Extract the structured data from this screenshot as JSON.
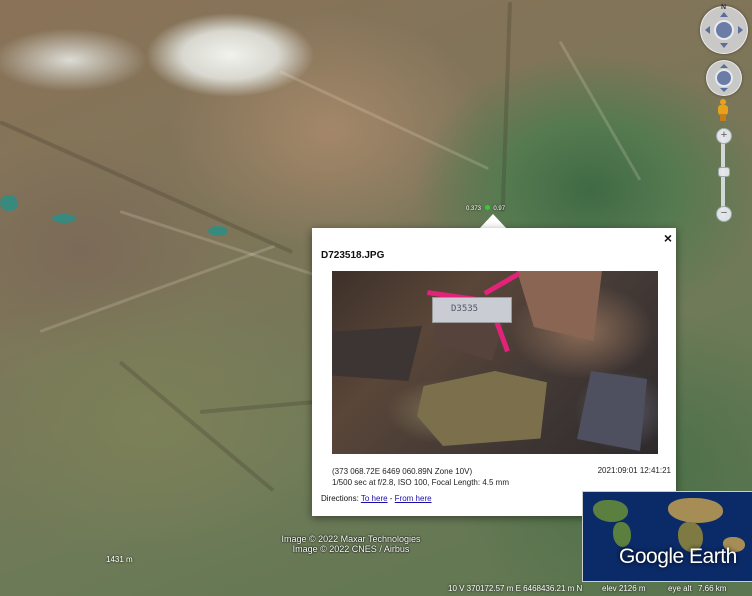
{
  "map": {
    "scale_label": "1431 m",
    "attribution_lines": [
      "Image © 2022 Maxar Technologies",
      "Image © 2022 CNES / Airbus"
    ],
    "marker_labels": [
      "0.373",
      "0.97"
    ]
  },
  "navigation": {
    "compass_north": "N",
    "zoom_in": "+",
    "zoom_out": "−"
  },
  "popup": {
    "title": "D723518.JPG",
    "close_symbol": "×",
    "photo_tag_text": "D3535",
    "coordinates": "(373 068.72E 6469 060.89N Zone 10V)",
    "exposure": "1/500 sec at f/2.8, ISO 100, Focal Length: 4.5 mm",
    "datetime": "2021:09:01 12:41:21",
    "directions_prefix": "Directions:",
    "to_here": "To here",
    "separator": " - ",
    "from_here": "From here"
  },
  "status_bar": {
    "coordinates": "10 V 370172.57 m E 6468436.21 m N",
    "elevation": "elev  2126 m",
    "eye_alt_label": "eye alt",
    "eye_alt_value": "7.66 km"
  },
  "overview": {
    "logo_text": "Google Earth"
  }
}
